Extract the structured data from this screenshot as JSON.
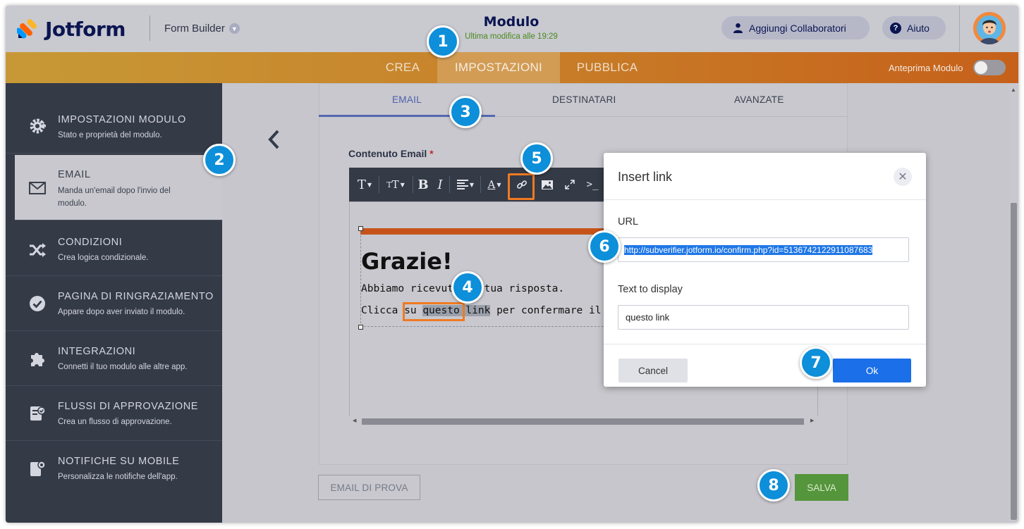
{
  "header": {
    "logo_text": "Jotform",
    "builder_label": "Form Builder",
    "form_title": "Modulo",
    "last_modified": "Ultima modifica alle 19:29",
    "collab_button": "Aggiungi Collaboratori",
    "help_button": "Aiuto"
  },
  "nav": {
    "tabs": [
      {
        "label": "CREA"
      },
      {
        "label": "IMPOSTAZIONI"
      },
      {
        "label": "PUBBLICA"
      }
    ],
    "active_tab": "IMPOSTAZIONI",
    "preview_label": "Anteprima Modulo",
    "preview_on": false
  },
  "sidebar": {
    "items": [
      {
        "title": "IMPOSTAZIONI MODULO",
        "desc": "Stato e proprietà del modulo.",
        "icon": "gear-icon"
      },
      {
        "title": "EMAIL",
        "desc": "Manda un'email dopo l'invio del modulo.",
        "icon": "envelope-icon"
      },
      {
        "title": "CONDIZIONI",
        "desc": "Crea logica condizionale.",
        "icon": "shuffle-icon"
      },
      {
        "title": "PAGINA DI RINGRAZIAMENTO",
        "desc": "Appare dopo aver inviato il modulo.",
        "icon": "check-circle-icon"
      },
      {
        "title": "INTEGRAZIONI",
        "desc": "Connetti il tuo modulo alle altre app.",
        "icon": "puzzle-icon"
      },
      {
        "title": "FLUSSI DI APPROVAZIONE",
        "desc": "Crea un flusso di approvazione.",
        "icon": "approval-icon"
      },
      {
        "title": "NOTIFICHE SU MOBILE",
        "desc": "Personalizza le notifiche dell'app.",
        "icon": "mobile-notification-icon"
      }
    ],
    "active_item": "EMAIL"
  },
  "subtabs": {
    "email": "EMAIL",
    "recipients": "DESTINATARI",
    "advanced": "AVANZATE"
  },
  "editor": {
    "field_label": "Contenuto Email",
    "required_mark": "*",
    "heading": "Grazie!",
    "line1": "Abbiamo ricevuto la tua risposta.",
    "line2_before": "Clicca su ",
    "line2_link": "questo link",
    "line2_after": " per confermare il tuo indirizzo"
  },
  "actions": {
    "test_email": "EMAIL DI PROVA",
    "save": "SALVA"
  },
  "dialog": {
    "title": "Insert link",
    "url_label": "URL",
    "url_value": "http://subverifier.jotform.io/confirm.php?id=5136742122911087683",
    "text_label": "Text to display",
    "text_value": "questo link",
    "cancel": "Cancel",
    "ok": "Ok"
  },
  "callouts": [
    "1",
    "2",
    "3",
    "4",
    "5",
    "6",
    "7",
    "8"
  ],
  "colors": {
    "brand_navy": "#0a1551",
    "nav_orange": "#c6601a",
    "callout_blue": "#0d8fd9",
    "highlight_orange": "#f07a21",
    "ok_blue": "#1b6fe8",
    "save_green": "#55953b"
  }
}
